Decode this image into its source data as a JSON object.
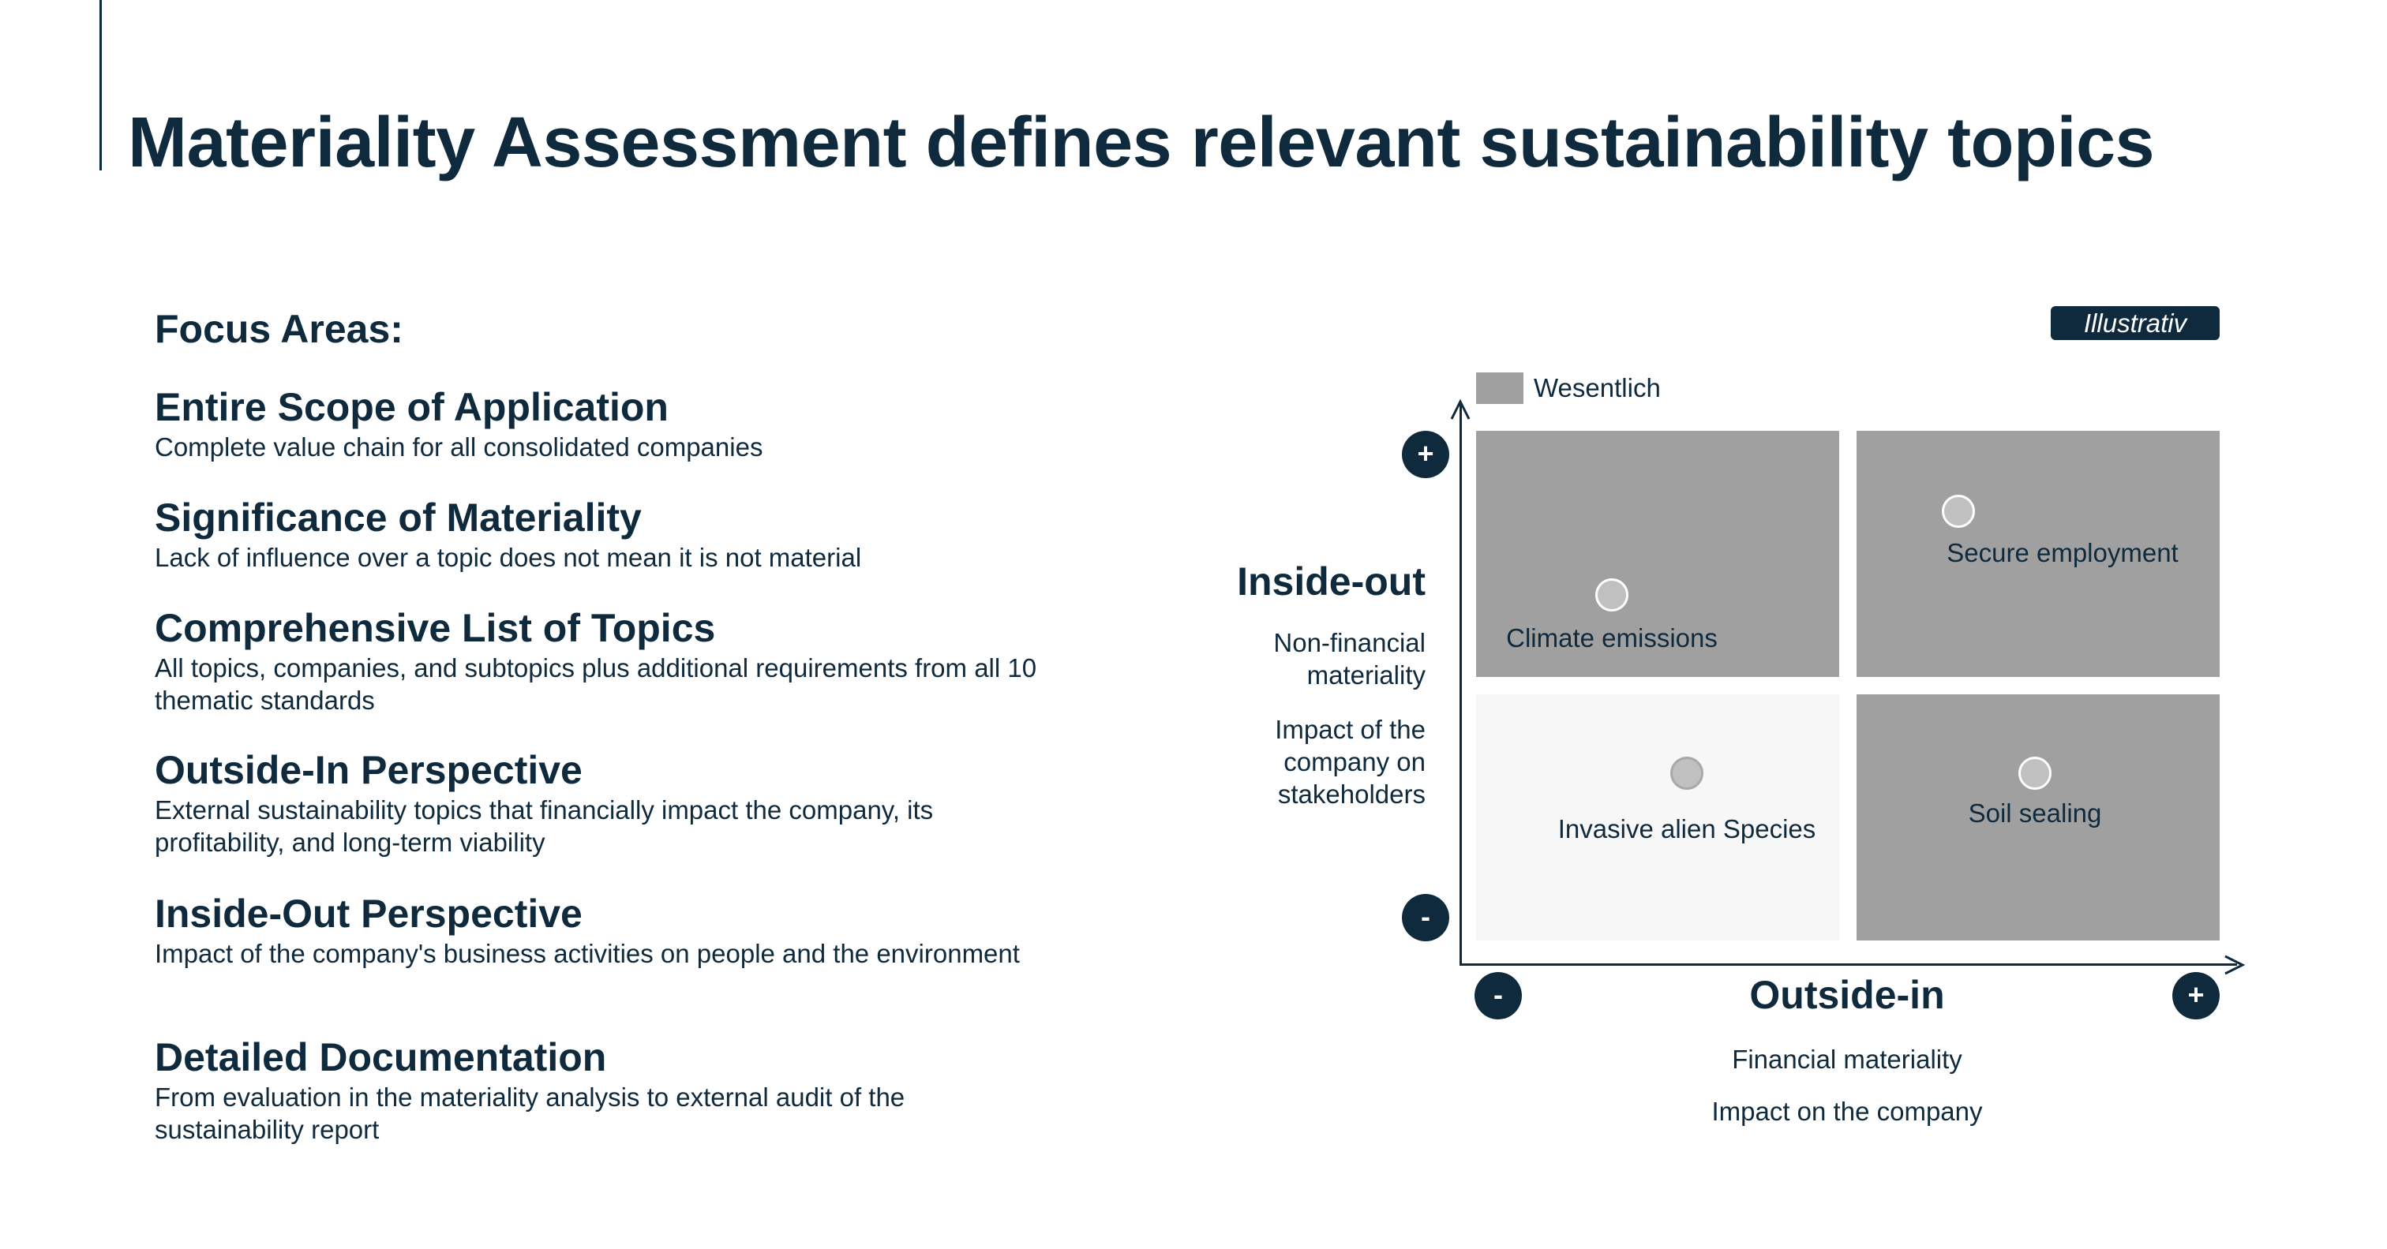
{
  "title": "Materiality Assessment defines relevant sustainability topics",
  "focus_heading": "Focus Areas:",
  "focus_items": [
    {
      "heading": "Entire Scope of Application",
      "text": "Complete value chain for all consolidated companies"
    },
    {
      "heading": "Significance of Materiality",
      "text": "Lack of influence over a topic does not mean it is not material"
    },
    {
      "heading": "Comprehensive List of Topics",
      "text": "All topics, companies, and subtopics plus additional requirements from all 10 thematic standards"
    },
    {
      "heading": "Outside-In Perspective",
      "text": "External sustainability topics that financially impact the company, its profitability, and long-term viability"
    },
    {
      "heading": "Inside-Out Perspective",
      "text": "Impact of the company's business activities on people and the environment"
    },
    {
      "heading": "Detailed Documentation",
      "text": "From evaluation in the materiality analysis to external audit of the sustainability report"
    }
  ],
  "matrix": {
    "badge": "Illustrativ",
    "legend": {
      "label": "Wesentlich",
      "color": "#a0a0a0"
    },
    "y_axis": {
      "title": "Inside-out",
      "subtitle1": "Non-financial materiality",
      "subtitle2": "Impact of the company on stakeholders",
      "plus": "+",
      "minus": "-"
    },
    "x_axis": {
      "title": "Outside-in",
      "subtitle1": "Financial materiality",
      "subtitle2": "Impact on the company",
      "plus": "+",
      "minus": "-"
    },
    "quadrants": [
      {
        "position": "top-left",
        "material": true,
        "topic": "Climate emissions"
      },
      {
        "position": "top-right",
        "material": true,
        "topic": "Secure employment"
      },
      {
        "position": "bottom-left",
        "material": false,
        "topic": "Invasive alien Species"
      },
      {
        "position": "bottom-right",
        "material": true,
        "topic": "Soil sealing"
      }
    ],
    "colors": {
      "material": "#a0a0a0",
      "not_material": "#f7f7f7",
      "accent": "#0f2a3d"
    }
  }
}
